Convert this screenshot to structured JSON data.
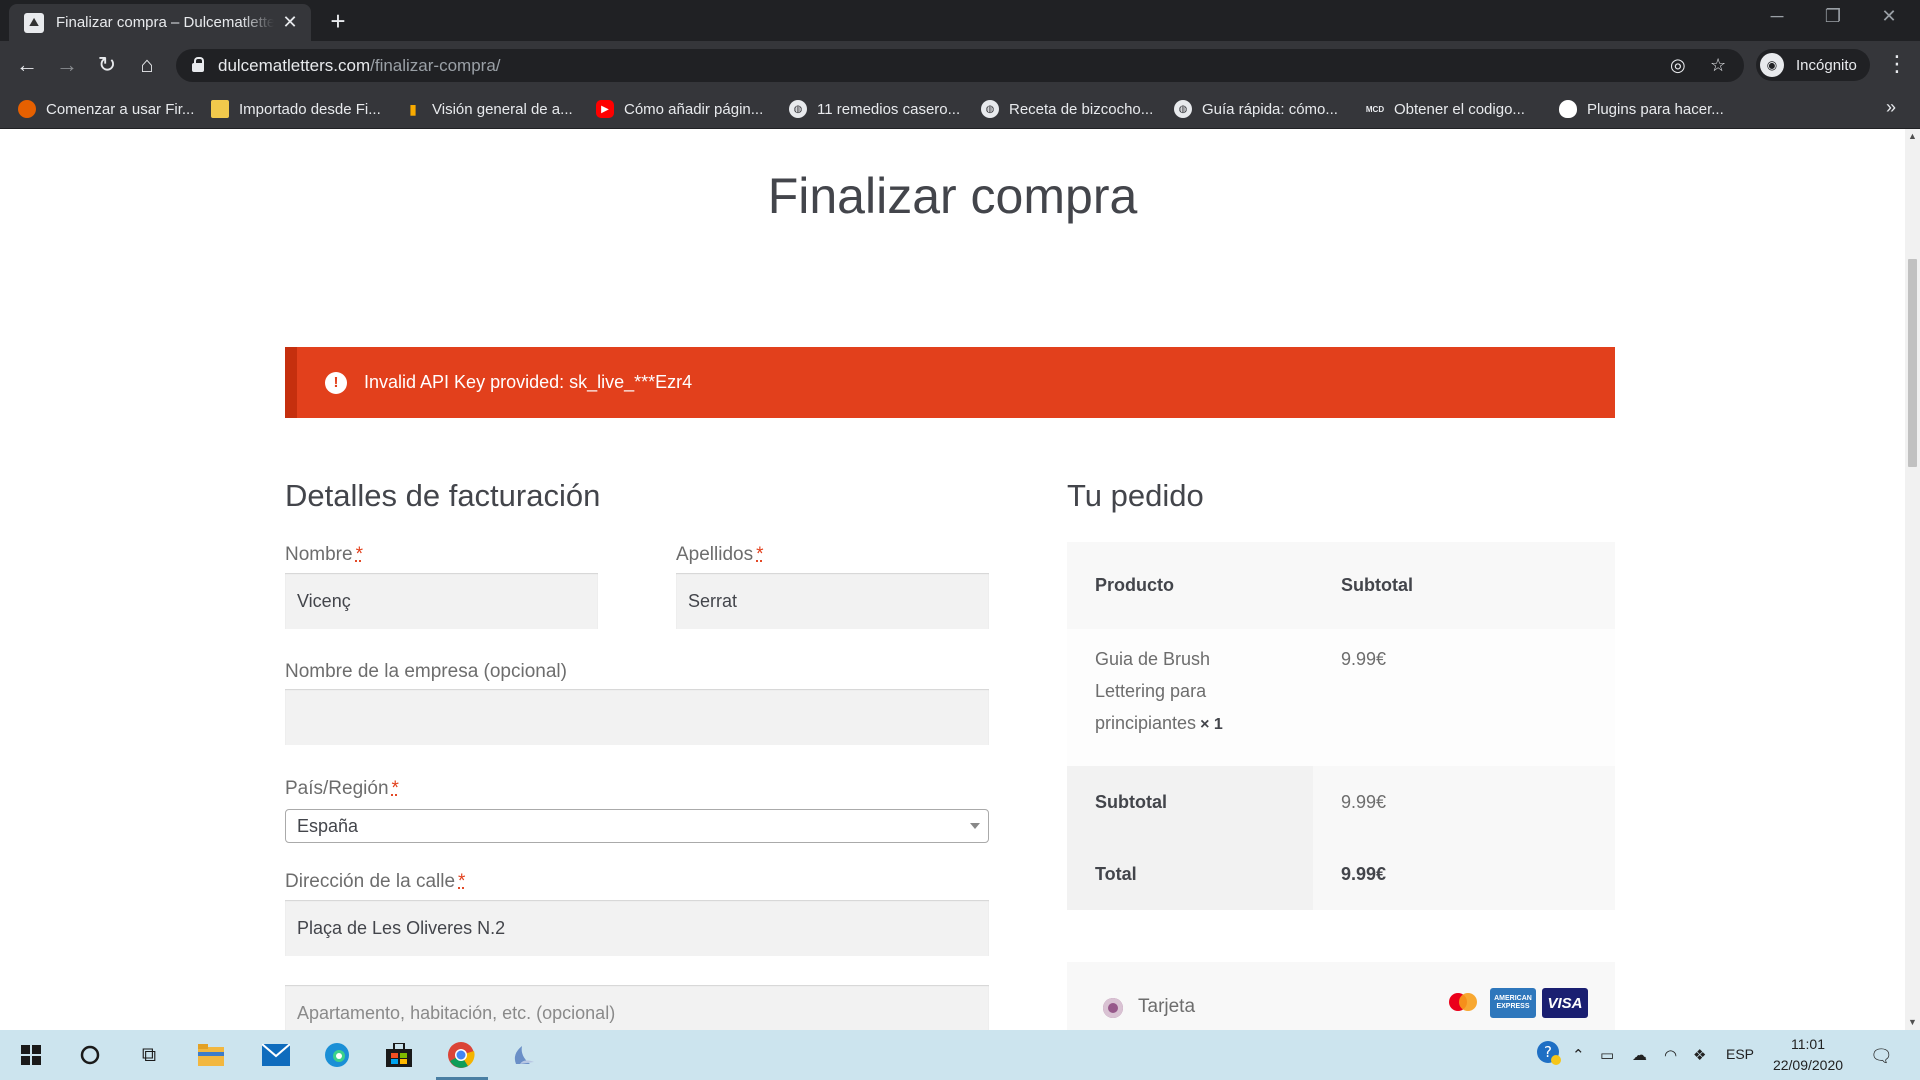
{
  "browser": {
    "tab_title": "Finalizar compra – Dulcematletters",
    "new_tab": "+",
    "url_domain": "dulcematletters.com",
    "url_path": "/finalizar-compra/",
    "incognito_label": "Incógnito",
    "bookmarks": [
      {
        "label": "Comenzar a usar Fir...",
        "icon": "firefox-icon",
        "color": "#e66000"
      },
      {
        "label": "Importado desde Fi...",
        "icon": "folder-icon",
        "color": "#f2c94c"
      },
      {
        "label": "Visión general de a...",
        "icon": "analytics-icon",
        "color": "#f9ab00"
      },
      {
        "label": "Cómo añadir págin...",
        "icon": "youtube-icon",
        "color": "#ff0000"
      },
      {
        "label": "11 remedios casero...",
        "icon": "globe-icon",
        "color": "#e8eaed"
      },
      {
        "label": "Receta de bizcocho...",
        "icon": "globe-icon",
        "color": "#e8eaed"
      },
      {
        "label": "Guía rápida: cómo...",
        "icon": "globe-icon",
        "color": "#e8eaed"
      },
      {
        "label": "Obtener el codigo...",
        "icon": "mcd-icon",
        "color": "#e8eaed"
      },
      {
        "label": "Plugins para hacer...",
        "icon": "egg-icon",
        "color": "#ffffff"
      }
    ]
  },
  "page": {
    "title": "Finalizar compra",
    "alert": "Invalid API Key provided: sk_live_***Ezr4",
    "billing": {
      "title": "Detalles de facturación",
      "required_mark": "*",
      "first_name_label": "Nombre",
      "first_name_value": "Vicenç",
      "last_name_label": "Apellidos",
      "last_name_value": "Serrat",
      "company_label": "Nombre de la empresa (opcional)",
      "company_value": "",
      "country_label": "País/Región",
      "country_value": "España",
      "street_label": "Dirección de la calle",
      "street_value": "Plaça de Les Oliveres N.2",
      "apartment_placeholder": "Apartamento, habitación, etc. (opcional)"
    },
    "order": {
      "title": "Tu pedido",
      "col_product": "Producto",
      "col_subtotal": "Subtotal",
      "item_name": "Guia de Brush Lettering para principiantes",
      "item_qty": "× 1",
      "item_price": "9.99€",
      "subtotal_label": "Subtotal",
      "subtotal_value": "9.99€",
      "total_label": "Total",
      "total_value": "9.99€"
    },
    "payment": {
      "method_label": "Tarjeta",
      "cards": [
        {
          "name": "mastercard",
          "label": "mastercard"
        },
        {
          "name": "amex",
          "label": "AMERICAN EXPRESS"
        },
        {
          "name": "visa",
          "label": "VISA"
        }
      ]
    }
  },
  "taskbar": {
    "language": "ESP",
    "time": "11:01",
    "date": "22/09/2020"
  }
}
